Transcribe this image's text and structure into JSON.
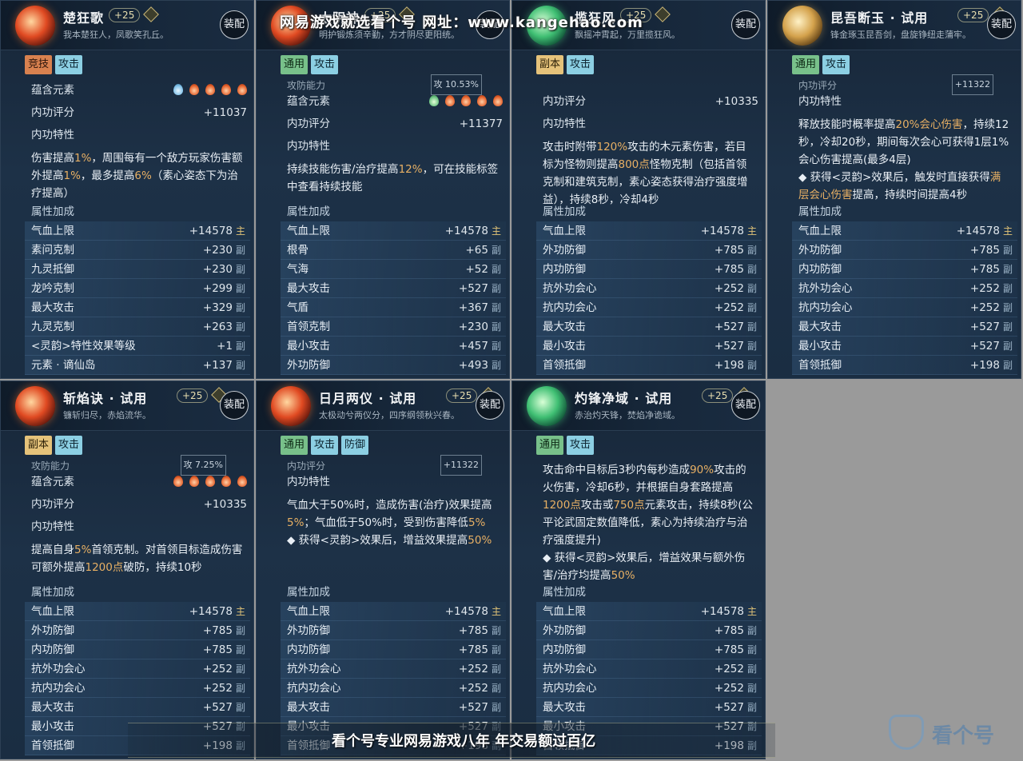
{
  "watermark_top": "网易游戏就选看个号   网址：www.kangehao.com",
  "banner_bottom": "看个号专业网易游戏八年   年交易额过百亿",
  "brand": "看个号",
  "cards": [
    {
      "title": "楚狂歌",
      "level": "+25",
      "subtitle": "我本楚狂人，凤歌笑孔丘。",
      "equip": "装配",
      "tags": [
        {
          "t": "竞技",
          "c": "red"
        },
        {
          "t": "攻击",
          "c": "blue"
        }
      ],
      "element_label": "蕴含元素",
      "elements": [
        "water",
        "fire",
        "fire",
        "fire",
        "fire"
      ],
      "score_label": "内功评分",
      "score": "+11037",
      "trait_label": "内功特性",
      "desc_parts": [
        {
          "t": "伤害提高"
        },
        {
          "t": "1%",
          "h": 1
        },
        {
          "t": "，周围每有一个敌方玩家伤害额外提高"
        },
        {
          "t": "1%",
          "h": 1
        },
        {
          "t": "，最多提高"
        },
        {
          "t": "6%",
          "h": 1
        },
        {
          "t": "（素心姿态下为治疗提高）"
        }
      ],
      "attr_label": "属性加成",
      "stats": [
        {
          "n": "气血上限",
          "v": "+14578",
          "k": "主"
        },
        {
          "n": "素问克制",
          "v": "+230",
          "k": "副"
        },
        {
          "n": "九灵抵御",
          "v": "+230",
          "k": "副"
        },
        {
          "n": "龙吟克制",
          "v": "+299",
          "k": "副"
        },
        {
          "n": "最大攻击",
          "v": "+329",
          "k": "副"
        },
        {
          "n": "九灵克制",
          "v": "+263",
          "k": "副"
        },
        {
          "n": "<灵韵>特性效果等级",
          "v": "+1",
          "k": "副"
        },
        {
          "n": "元素 · 谪仙岛",
          "v": "+137",
          "k": "副"
        }
      ]
    },
    {
      "title": "太阴神",
      "level": "+25",
      "subtitle": "明护锻炼须辛勤，方才阴尽更阳统。",
      "equip": "装配",
      "tags": [
        {
          "t": "通用",
          "c": "green"
        },
        {
          "t": "攻击",
          "c": "blue"
        }
      ],
      "cut_label": "攻防能力",
      "cut_box": "攻 10.53%",
      "element_label": "蕴含元素",
      "elements": [
        "wood",
        "fire",
        "fire",
        "fire",
        "fire"
      ],
      "score_label": "内功评分",
      "score": "+11377",
      "trait_label": "内功特性",
      "desc_parts": [
        {
          "t": "持续技能伤害/治疗提高"
        },
        {
          "t": "12%",
          "h": 1
        },
        {
          "t": "，可在技能标签中查看持续技能"
        }
      ],
      "attr_label": "属性加成",
      "stats": [
        {
          "n": "气血上限",
          "v": "+14578",
          "k": "主"
        },
        {
          "n": "根骨",
          "v": "+65",
          "k": "副"
        },
        {
          "n": "气海",
          "v": "+52",
          "k": "副"
        },
        {
          "n": "最大攻击",
          "v": "+527",
          "k": "副"
        },
        {
          "n": "气盾",
          "v": "+367",
          "k": "副"
        },
        {
          "n": "首领克制",
          "v": "+230",
          "k": "副"
        },
        {
          "n": "最小攻击",
          "v": "+457",
          "k": "副"
        },
        {
          "n": "外功防御",
          "v": "+493",
          "k": "副"
        }
      ]
    },
    {
      "title": "揽狂风",
      "level": "+25",
      "subtitle": "飘摇冲霄起，万里揽狂风。",
      "equip": "装配",
      "tags": [
        {
          "t": "副本",
          "c": "gold"
        },
        {
          "t": "攻击",
          "c": "blue"
        }
      ],
      "score_label": "内功评分",
      "score": "+10335",
      "trait_label": "内功特性",
      "desc_parts": [
        {
          "t": "攻击时附带"
        },
        {
          "t": "120%",
          "h": 1
        },
        {
          "t": "攻击的木元素伤害，若目标为怪物则提高"
        },
        {
          "t": "800点",
          "h": 1
        },
        {
          "t": "怪物克制（包括首领克制和建筑克制，素心姿态获得治疗强度增益），持续8秒，冷却4秒"
        }
      ],
      "attr_label": "属性加成",
      "stats": [
        {
          "n": "气血上限",
          "v": "+14578",
          "k": "主"
        },
        {
          "n": "外功防御",
          "v": "+785",
          "k": "副"
        },
        {
          "n": "内功防御",
          "v": "+785",
          "k": "副"
        },
        {
          "n": "抗外功会心",
          "v": "+252",
          "k": "副"
        },
        {
          "n": "抗内功会心",
          "v": "+252",
          "k": "副"
        },
        {
          "n": "最大攻击",
          "v": "+527",
          "k": "副"
        },
        {
          "n": "最小攻击",
          "v": "+527",
          "k": "副"
        },
        {
          "n": "首领抵御",
          "v": "+198",
          "k": "副"
        }
      ]
    },
    {
      "title": "昆吾断玉 · 试用",
      "level": "+25",
      "subtitle": "锋金琢玉昆吾剑，盘旋铮纽走蒲牢。",
      "equip": "装配",
      "tags": [
        {
          "t": "通用",
          "c": "green"
        },
        {
          "t": "攻击",
          "c": "blue"
        }
      ],
      "cut_label": "内功评分",
      "cut_box": "+11322",
      "trait_label": "内功特性",
      "desc_parts": [
        {
          "t": "释放技能时概率提高"
        },
        {
          "t": "20%会心伤害",
          "h": 1
        },
        {
          "t": "，持续12秒，冷却20秒，期间每次会心可获得1层1%会心伤害提高(最多4层)"
        },
        {
          "t": "\n◆ 获得<灵韵>效果后，触发时直接获得"
        },
        {
          "t": "满层会心伤害",
          "h": 1
        },
        {
          "t": "提高，持续时间提高4秒"
        }
      ],
      "attr_label": "属性加成",
      "stats": [
        {
          "n": "气血上限",
          "v": "+14578",
          "k": "主"
        },
        {
          "n": "外功防御",
          "v": "+785",
          "k": "副"
        },
        {
          "n": "内功防御",
          "v": "+785",
          "k": "副"
        },
        {
          "n": "抗外功会心",
          "v": "+252",
          "k": "副"
        },
        {
          "n": "抗内功会心",
          "v": "+252",
          "k": "副"
        },
        {
          "n": "最大攻击",
          "v": "+527",
          "k": "副"
        },
        {
          "n": "最小攻击",
          "v": "+527",
          "k": "副"
        },
        {
          "n": "首领抵御",
          "v": "+198",
          "k": "副"
        }
      ]
    },
    {
      "title": "斩焰诀 · 试用",
      "level": "+25",
      "subtitle": "镰斩归尽，赤焰流华。",
      "equip": "装配",
      "tags": [
        {
          "t": "副本",
          "c": "gold"
        },
        {
          "t": "攻击",
          "c": "blue"
        }
      ],
      "cut_label": "攻防能力",
      "cut_box": "攻 7.25%",
      "element_label": "蕴含元素",
      "elements": [
        "fire",
        "fire",
        "fire",
        "fire",
        "fire"
      ],
      "score_label": "内功评分",
      "score": "+10335",
      "trait_label": "内功特性",
      "desc_parts": [
        {
          "t": "提高自身"
        },
        {
          "t": "5%",
          "h": 1
        },
        {
          "t": "首领克制。对首领目标造成伤害可额外提高"
        },
        {
          "t": "1200点",
          "h": 1
        },
        {
          "t": "破防，持续10秒"
        }
      ],
      "attr_label": "属性加成",
      "stats": [
        {
          "n": "气血上限",
          "v": "+14578",
          "k": "主"
        },
        {
          "n": "外功防御",
          "v": "+785",
          "k": "副"
        },
        {
          "n": "内功防御",
          "v": "+785",
          "k": "副"
        },
        {
          "n": "抗外功会心",
          "v": "+252",
          "k": "副"
        },
        {
          "n": "抗内功会心",
          "v": "+252",
          "k": "副"
        },
        {
          "n": "最大攻击",
          "v": "+527",
          "k": "副"
        },
        {
          "n": "最小攻击",
          "v": "+527",
          "k": "副"
        },
        {
          "n": "首领抵御",
          "v": "+198",
          "k": "副"
        }
      ]
    },
    {
      "title": "日月两仪 · 试用",
      "level": "+25",
      "subtitle": "太极动兮两仪分，四序纲领秋兴春。",
      "equip": "装配",
      "tags": [
        {
          "t": "通用",
          "c": "green"
        },
        {
          "t": "攻击",
          "c": "blue"
        },
        {
          "t": "防御",
          "c": "blue"
        }
      ],
      "cut_label": "内功评分",
      "cut_box": "+11322",
      "trait_label": "内功特性",
      "desc_parts": [
        {
          "t": "气血大于50%时，造成伤害(治疗)效果提高"
        },
        {
          "t": "5%",
          "h": 1
        },
        {
          "t": "；气血低于50%时，受到伤害降低"
        },
        {
          "t": "5%",
          "h": 1
        },
        {
          "t": "\n◆ 获得<灵韵>效果后，增益效果提高"
        },
        {
          "t": "50%",
          "h": 1
        }
      ],
      "attr_label": "属性加成",
      "stats": [
        {
          "n": "气血上限",
          "v": "+14578",
          "k": "主"
        },
        {
          "n": "外功防御",
          "v": "+785",
          "k": "副"
        },
        {
          "n": "内功防御",
          "v": "+785",
          "k": "副"
        },
        {
          "n": "抗外功会心",
          "v": "+252",
          "k": "副"
        },
        {
          "n": "抗内功会心",
          "v": "+252",
          "k": "副"
        },
        {
          "n": "最大攻击",
          "v": "+527",
          "k": "副"
        },
        {
          "n": "最小攻击",
          "v": "+527",
          "k": "副"
        },
        {
          "n": "首领抵御",
          "v": "+198",
          "k": "副"
        }
      ]
    },
    {
      "title": "灼锋净域 · 试用",
      "level": "+25",
      "subtitle": "赤治灼天锋，焚焰净诡域。",
      "equip": "装配",
      "tags": [
        {
          "t": "通用",
          "c": "green"
        },
        {
          "t": "攻击",
          "c": "blue"
        }
      ],
      "desc_parts": [
        {
          "t": "攻击命中目标后3秒内每秒造成"
        },
        {
          "t": "90%",
          "h": 1
        },
        {
          "t": "攻击的火伤害，冷却6秒，并根据自身套路提高"
        },
        {
          "t": "1200点",
          "h": 1
        },
        {
          "t": "攻击或"
        },
        {
          "t": "750点",
          "h": 1
        },
        {
          "t": "元素攻击，持续8秒(公平论武固定数值降低，素心为持续治疗与治疗强度提升)"
        },
        {
          "t": "\n◆ 获得<灵韵>效果后，增益效果与额外伤害/治疗均提高"
        },
        {
          "t": "50%",
          "h": 1
        }
      ],
      "attr_label": "属性加成",
      "stats": [
        {
          "n": "气血上限",
          "v": "+14578",
          "k": "主"
        },
        {
          "n": "外功防御",
          "v": "+785",
          "k": "副"
        },
        {
          "n": "内功防御",
          "v": "+785",
          "k": "副"
        },
        {
          "n": "抗外功会心",
          "v": "+252",
          "k": "副"
        },
        {
          "n": "抗内功会心",
          "v": "+252",
          "k": "副"
        },
        {
          "n": "最大攻击",
          "v": "+527",
          "k": "副"
        },
        {
          "n": "最小攻击",
          "v": "+527",
          "k": "副"
        },
        {
          "n": "首领抵御",
          "v": "+198",
          "k": "副"
        }
      ]
    }
  ]
}
